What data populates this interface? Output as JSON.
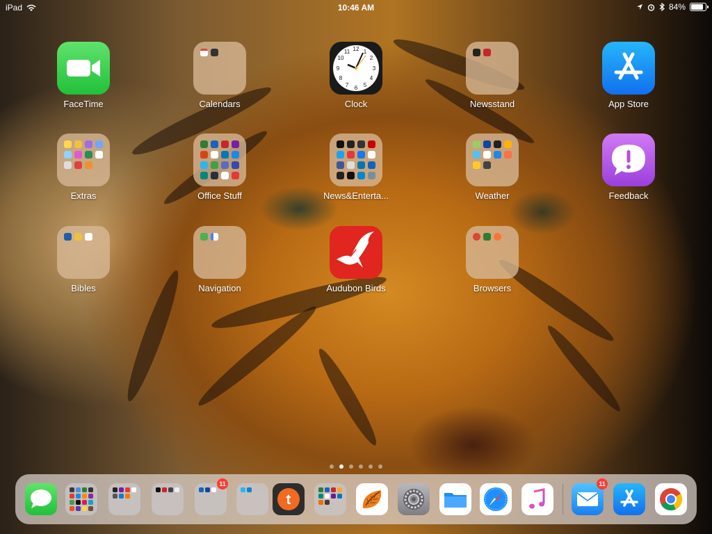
{
  "status_bar": {
    "device": "iPad",
    "time": "10:46 AM",
    "battery_percent": "84%",
    "battery_level": 0.84,
    "icons": [
      "wifi-icon",
      "location-arrow-icon",
      "alarm-icon",
      "bluetooth-icon",
      "battery-icon"
    ]
  },
  "home_screen": {
    "apps": [
      {
        "id": "facetime",
        "label": "FaceTime"
      },
      {
        "id": "calendars",
        "label": "Calendars"
      },
      {
        "id": "clock",
        "label": "Clock"
      },
      {
        "id": "newsstand",
        "label": "Newsstand"
      },
      {
        "id": "appstore",
        "label": "App Store"
      },
      {
        "id": "extras",
        "label": "Extras"
      },
      {
        "id": "officestuff",
        "label": "Office Stuff"
      },
      {
        "id": "news",
        "label": "News&Enterta..."
      },
      {
        "id": "weather",
        "label": "Weather"
      },
      {
        "id": "feedback",
        "label": "Feedback"
      },
      {
        "id": "bibles",
        "label": "Bibles"
      },
      {
        "id": "navigation",
        "label": "Navigation"
      },
      {
        "id": "audubon",
        "label": "Audubon Birds"
      },
      {
        "id": "browsers",
        "label": "Browsers"
      }
    ],
    "page_count": 6,
    "current_page": 2
  },
  "dock": {
    "items": [
      {
        "id": "messages",
        "icon": "messages-icon"
      },
      {
        "id": "folder-1",
        "icon": "folder-icon"
      },
      {
        "id": "folder-2",
        "icon": "folder-icon"
      },
      {
        "id": "folder-3",
        "icon": "folder-icon"
      },
      {
        "id": "folder-4",
        "icon": "folder-icon",
        "badge": "11"
      },
      {
        "id": "folder-5",
        "icon": "folder-icon"
      },
      {
        "id": "tapatalk",
        "icon": "tapatalk-icon"
      },
      {
        "id": "folder-6",
        "icon": "folder-icon"
      },
      {
        "id": "leaf-app",
        "icon": "leaf-icon"
      },
      {
        "id": "settings",
        "icon": "gear-icon"
      },
      {
        "id": "files",
        "icon": "files-folder-icon"
      },
      {
        "id": "safari",
        "icon": "compass-icon"
      },
      {
        "id": "music",
        "icon": "music-note-icon"
      },
      {
        "id": "mail",
        "icon": "envelope-icon",
        "badge": "11"
      },
      {
        "id": "appstore-recent",
        "icon": "app-store-icon"
      },
      {
        "id": "chrome",
        "icon": "chrome-icon"
      }
    ]
  },
  "colors": {
    "facetime_green": "#34c759",
    "appstore_blue": "#1a8cf0",
    "feedback_purple": "#b34fe0",
    "badge_red": "#ff3b30",
    "audubon_red": "#e0261e"
  }
}
